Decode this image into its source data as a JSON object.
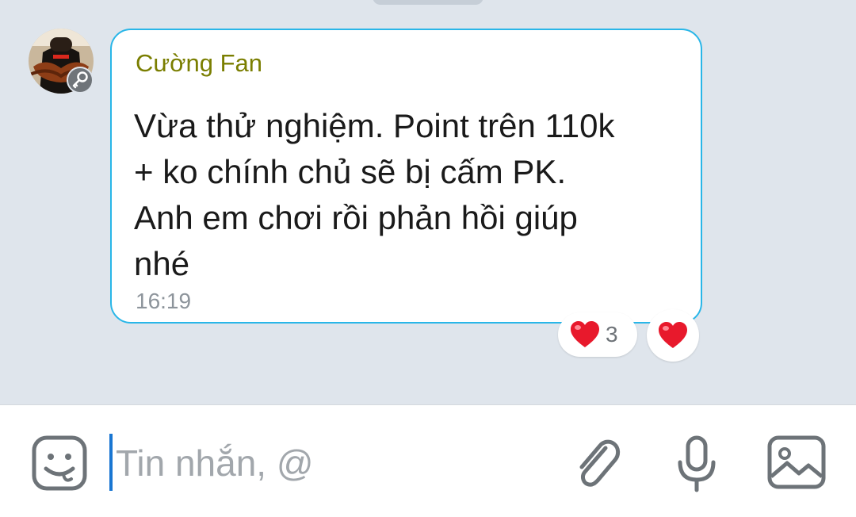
{
  "message": {
    "sender": "Cường Fan",
    "lines": [
      "Vừa thử nghiệm. Point trên 110k",
      "+ ko chính chủ sẽ bị cấm PK.",
      "Anh em chơi rồi phản hồi giúp",
      "nhé"
    ],
    "time": "16:19",
    "reaction_count": "3"
  },
  "composer": {
    "placeholder": "Tin nhắn, @"
  },
  "icons": {
    "sticker": "sticker-face-icon",
    "attach": "paperclip-icon",
    "mic": "microphone-icon",
    "image": "image-icon",
    "heart": "heart-icon",
    "key_badge": "key-icon"
  },
  "colors": {
    "chat_background": "#dfe5ec",
    "bubble_border": "#29b6e8",
    "sender_name": "#7a7e00",
    "caret": "#1976d2",
    "heart": "#e8192c"
  }
}
